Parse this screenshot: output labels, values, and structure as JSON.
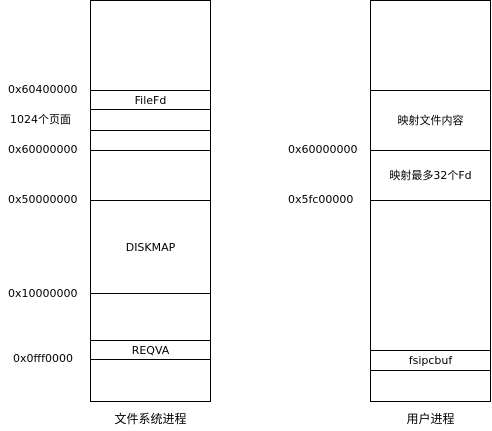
{
  "fs_process": {
    "caption": "文件系统进程",
    "addresses": [
      "0x60400000",
      "1024个页面",
      "0x60000000",
      "0x50000000",
      "0x10000000",
      "0x0fff0000"
    ],
    "regions": {
      "filefd": "FileFd",
      "diskmap": "DISKMAP",
      "reqva": "REQVA"
    }
  },
  "user_process": {
    "caption": "用户进程",
    "addresses": [
      "0x60000000",
      "0x5fc00000"
    ],
    "regions": {
      "mapped_file_content": "映射文件内容",
      "mapped_fd": "映射最多32个Fd",
      "fsipcbuf": "fsipcbuf"
    }
  }
}
